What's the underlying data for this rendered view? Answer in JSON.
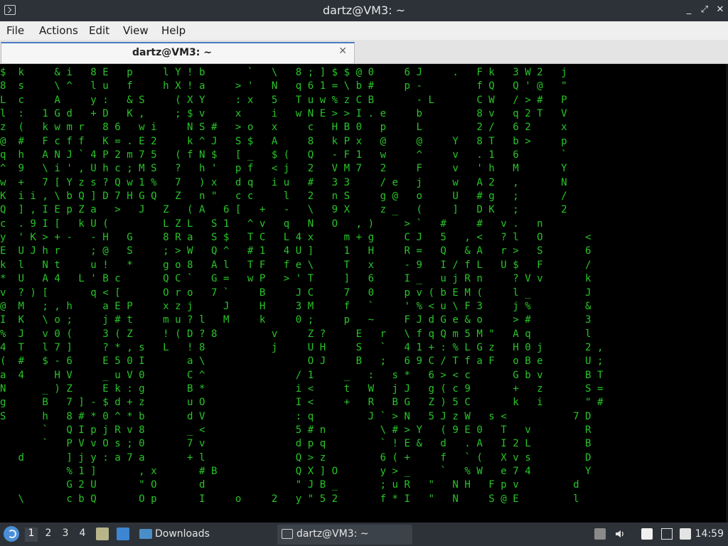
{
  "window": {
    "title": "dartz@VM3: ~",
    "controls": {
      "minimize": "_",
      "maximize": "⤢",
      "close": "✕"
    }
  },
  "menubar": {
    "items": [
      "File",
      "Actions",
      "Edit",
      "View",
      "Help"
    ]
  },
  "tab": {
    "label": "dartz@VM3: ~",
    "close": "✕"
  },
  "terminal": {
    "lines": [
      "$  k     & i   8 E   p     l Y ! b       `   \\   8 ; ] $ $ @ 0     6 J     .   F k   3 W 2   j",
      "8  s     \\ ^   l u   f     h X ! a     > '   N   q 6 1 = \\ b #     p -         f Q   Q ' @   \"",
      "L  c     A     y :   & S     ( X Y     : x   5   T u w % z C B       - L       C W   / > #   P",
      "l  :   1 G d   + D   K ,     ; $ v     x     i   w N E > > I . e     b         8 v   q 2 T   V",
      "z  (   k w m r   8 6   w i     N S #   > o   x     c   H B 0   p     L         2 /   6 2     x",
      "@  #   F c f f   K = . E 2     k ^ J   S $   A     8   k P x   @     @     Y   8 T   b >     p",
      "q  h   A N J ` 4 P 2 m 7 5   ( f N $   [ _   $ (   Q   - F 1   w     ^     v   . 1   6       `",
      "^  9   \\ i ' , U h c ; M S   ?   h '   p f   < j   2   V M 7   2     F     v   ' h   M       Y",
      "w  +   7 [ Y z s ? Q w 1 %   7   ) x   d q   i u   #   3 3     / e   j     w   A 2   ,       N",
      "K  i i , \\ b Q ] D 7 H G Q   Z   n \"   c c     l   2   n S     g @   o     U   # g   ;       /",
      "Q  ] , I E p Z a   >   J   Z   ( A   6 [   +   -   \\   9 X     z _   (     ]   D K   ;       2",
      "c  . 9 I [   k U (         L Z L   S 1   ^ v   q   N   O   , )     > `   #     #   v .   n",
      "y  ' K > + -   - H   G     8 R a   S $   T C   L 4 x     m + g     C J   5   , <   ? l   O       <",
      "E  U J h r     ; @   S     ; > W   Q ^   # 1   4 U ]     1   H     R =   Q   & A   r >   S       6",
      "k  l   N t     u !   *     g o 8   A l   T F   f e \\     T   x     - 9   I / f L   U $   F       /",
      "*  U   A 4   L ' B c       Q C `   G =   w P   > ' T     ]   6     I _   u j R n     ? V v       k",
      "v  ? ) [       q < [       O r o   7 `     B     J C     7   0     p v ( b E M (     l _         J",
      "@  M   ; , h     a E P     x z j     J     H     3 M     f   `     ' % < u \\ F 3     j %         &",
      "I  K   \\ o ;     j # t     m u ? l   M     k     0 ;     p   ~     F J d G e & o     > #         3",
      "%  J   v 0 (     3 ( Z     ! ( D ? 8         v     Z ?     E   r   \\ f q Q m 5 M \"   A q         l",
      "4  T   l 7 ]     ? * , s   L   ! 8           j     U H     S   `   4 1 + : % L G z   H 0 j       2 ,",
      "(  #   $ - 6     E 5 0 I       a \\                 O J     B   ;   6 9 C / T f a F   o B e       U ;",
      "a  4     H V     _ u V 0       C ^               / 1     _   :   s *   6 > < c       G b v       B T",
      "N      _ ) Z     E k : g       B *               i <     t   W   j J   g ( c 9       +   z       S =",
      "g      B   7 ] - $ d + z       u O               I <     +   R   B G   Z ) 5 C       k   i       \" #",
      "S      h   8 # * 0 ^ * b       d V               : q         J ` > N   5 J z W   s <           7 D",
      "       `   Q I p j R v 8       _ <               5 # n         \\ # > Y   ( 9 E 0   T   v         R",
      "       `   P V v O s ; 0       7 v               d p q         ` ! E &   d   . A   I 2 L         B",
      "   d       ] j y : a 7 a       + l               Q > z         6 ( +     f   ` (   X v s         D",
      "           % 1 ]       , x       # B             Q X ] O       y > _     `   % W   e 7 4         Y",
      "           G 2 U       \" O       d               \" J B _       ; u R   \"   N H   F p v         d",
      "   \\       c b Q       O p       I     o     2   y \" 5 2       f * I   \"   N     S @ E         l"
    ]
  },
  "taskbar": {
    "workspaces": [
      "1",
      "2",
      "3",
      "4"
    ],
    "active_workspace": "1",
    "tasks": [
      {
        "label": "Downloads",
        "icon": "folder-icon"
      },
      {
        "label": "dartz@VM3: ~",
        "icon": "terminal-icon"
      }
    ],
    "clock": "14:59"
  },
  "colors": {
    "matrix_green": "#27c427",
    "chrome_dark": "#2d3238",
    "menubar": "#efefef"
  }
}
